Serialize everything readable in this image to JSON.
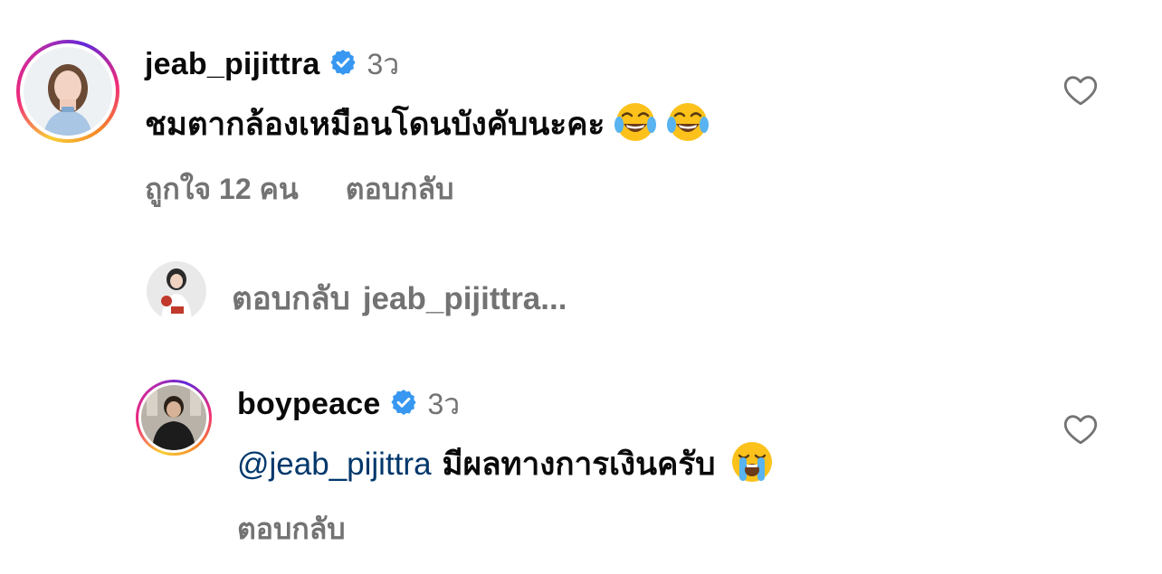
{
  "comment1": {
    "username": "jeab_pijittra",
    "time": "3ว",
    "text": "ชมตากล้องเหมือนโดนบังคับนะคะ",
    "likes_label": "ถูกใจ 12 คน",
    "reply_label": "ตอบกลับ",
    "verified_icon": "verified-badge-icon",
    "emoji": "face-with-tears-of-joy"
  },
  "reply_box": {
    "prefix": "ตอบกลับ",
    "target": "jeab_pijittra..."
  },
  "comment2": {
    "username": "boypeace",
    "time": "3ว",
    "mention": "@jeab_pijittra",
    "text": "มีผลทางการเงินครับ",
    "reply_label": "ตอบกลับ",
    "verified_icon": "verified-badge-icon",
    "emoji": "loudly-crying-face"
  },
  "colors": {
    "text": "#0a0a0a",
    "muted": "#737373",
    "mention": "#00376b",
    "verified": "#3897f0"
  }
}
